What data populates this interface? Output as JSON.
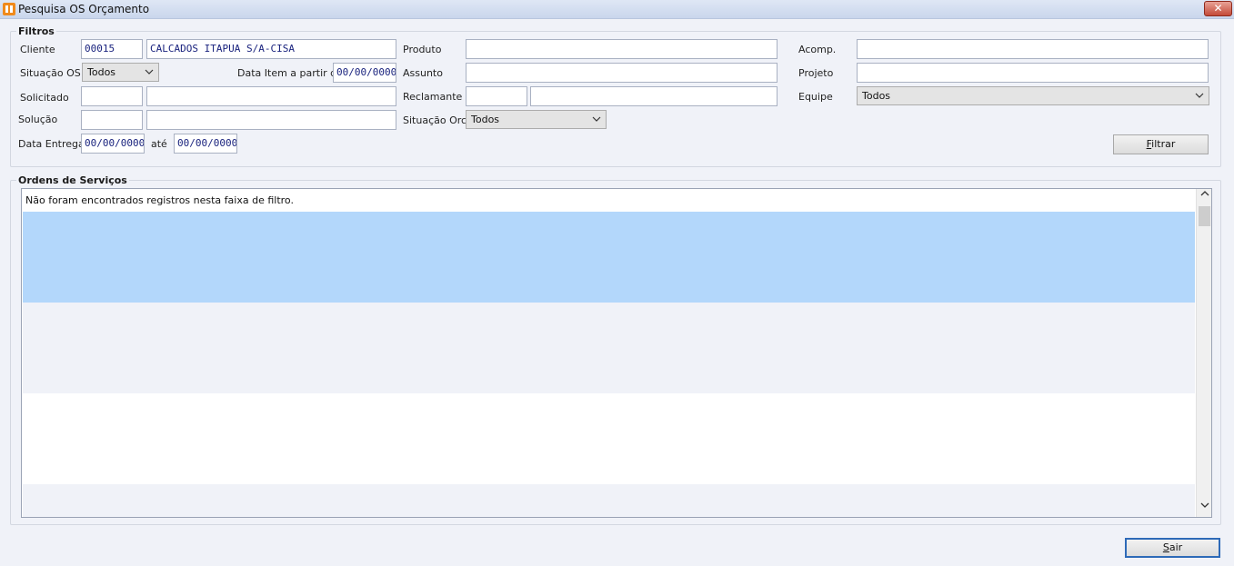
{
  "window": {
    "title": "Pesquisa OS Orçamento",
    "close_label": "✕"
  },
  "filtros": {
    "legend": "Filtros",
    "cliente": {
      "label": "Cliente",
      "code": "00015",
      "name": "CALCADOS ITAPUA S/A-CISA"
    },
    "situacao_os": {
      "label": "Situação OS",
      "value": "Todos"
    },
    "data_item": {
      "label": "Data Item a partir de",
      "value": "00/00/0000"
    },
    "solicitado": {
      "label": "Solicitado",
      "code": "",
      "name": ""
    },
    "solucao": {
      "label": "Solução",
      "code": "",
      "name": ""
    },
    "data_entrega": {
      "label": "Data Entrega",
      "from": "00/00/0000",
      "to_label": "até",
      "to": "00/00/0000"
    },
    "produto": {
      "label": "Produto",
      "value": ""
    },
    "assunto": {
      "label": "Assunto",
      "value": ""
    },
    "reclamante": {
      "label": "Reclamante",
      "code": "",
      "name": ""
    },
    "situacao_orc": {
      "label": "Situação Orc.",
      "value": "Todos"
    },
    "acomp": {
      "label": "Acomp.",
      "value": ""
    },
    "projeto": {
      "label": "Projeto",
      "value": ""
    },
    "equipe": {
      "label": "Equipe",
      "value": "Todos"
    },
    "filtrar": {
      "mnemonic": "F",
      "rest": "iltrar"
    }
  },
  "ordens": {
    "legend": "Ordens de Serviços",
    "empty_message": "Não foram encontrados registros nesta faixa de filtro."
  },
  "sair": {
    "mnemonic": "S",
    "rest": "air"
  },
  "colors": {
    "selected_row": "#b3d7fb",
    "alt_row": "#f0f2f8"
  }
}
